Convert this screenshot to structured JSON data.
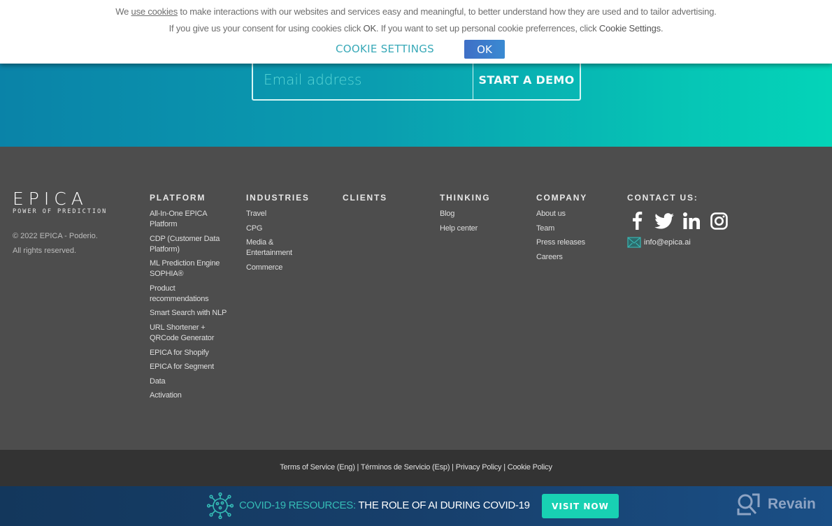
{
  "cookie_banner": {
    "line1_prefix": "We ",
    "line1_link": "use cookies",
    "line1_suffix": " to make interactions with our websites and services easy and meaningful, to better understand how they are used and to tailor advertising.",
    "line2_a": "If you give us your consent for using cookies click ",
    "line2_ok": "OK",
    "line2_b": ". If you want to set up personal cookie preferrences, click ",
    "line2_settings": "Cookie Settings",
    "line2_end": ".",
    "settings_button": "COOKIE SETTINGS",
    "ok_button": "OK"
  },
  "demo_form": {
    "email_placeholder": "Email address",
    "email_value": "",
    "submit_label": "START A DEMO"
  },
  "brand": {
    "logo": "EPICA",
    "tagline": "POWER OF PREDICTION",
    "copyright_line1": "© 2022 EPICA - Poderio.",
    "copyright_line2": "All rights reserved."
  },
  "columns": {
    "platform": {
      "title": "PLATFORM",
      "items": [
        "All-In-One EPICA Platform",
        "CDP (Customer Data Platform)",
        "ML Prediction Engine SOPHIA®",
        "Product recommendations",
        "Smart Search with NLP",
        "URL Shortener + QRCode Generator",
        "EPICA for Shopify",
        "EPICA for Segment",
        "Data",
        "Activation"
      ]
    },
    "industries": {
      "title": "INDUSTRIES",
      "items": [
        "Travel",
        "CPG",
        "Media & Entertainment",
        "Commerce"
      ]
    },
    "clients": {
      "title": "CLIENTS"
    },
    "thinking": {
      "title": "THINKING",
      "items": [
        "Blog",
        "Help center"
      ]
    },
    "company": {
      "title": "COMPANY",
      "items": [
        "About us",
        "Team",
        "Press releases",
        "Careers"
      ]
    },
    "contact": {
      "title": "CONTACT US:",
      "socials": [
        "facebook-icon",
        "twitter-icon",
        "linkedin-icon",
        "instagram-icon"
      ],
      "email": "info@epica.ai"
    }
  },
  "legal": {
    "links": [
      "Terms of Service (Eng)",
      "Términos de Servicio (Esp)",
      "Privacy Policy",
      "Cookie Policy"
    ],
    "separator": " | "
  },
  "covid_banner": {
    "lead": "COVID-19 RESOURCES:",
    "text": " THE ROLE OF AI DURING COVID-19",
    "button": "VISIT NOW"
  },
  "revain": {
    "label": "Revain"
  },
  "colors": {
    "hero_gradient_start": "#0a83a8",
    "hero_gradient_end": "#04d4b8",
    "footer_bg": "#4d4d4d",
    "legal_bg": "#333333",
    "covid_bg": "#173f6b",
    "accent_teal": "#18d1b3",
    "ok_blue": "#3a7fce"
  }
}
